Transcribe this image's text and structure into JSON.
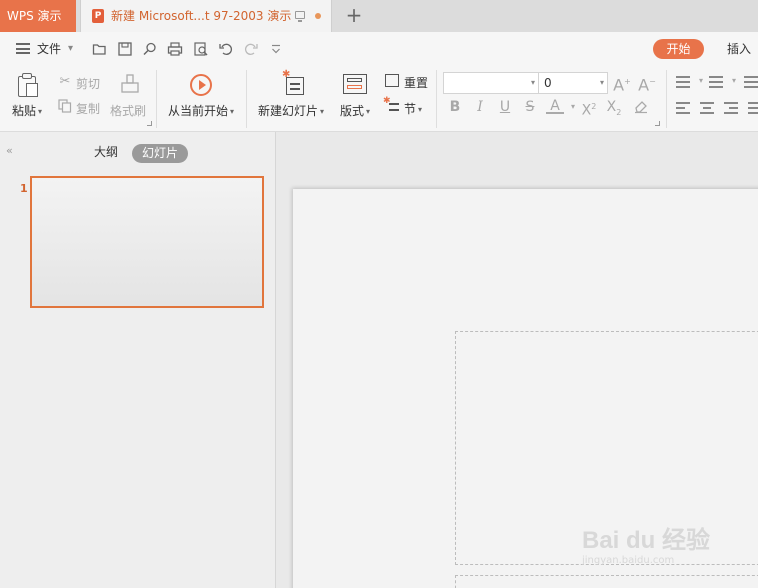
{
  "titlebar": {
    "app_tab": "WPS 演示",
    "doc_tab_title": "新建 Microsoft...t 97-2003 演示",
    "new_tab": "+"
  },
  "quickbar": {
    "file_menu": "文件",
    "start_tab": "开始",
    "insert_tab": "插入"
  },
  "ribbon": {
    "paste": "粘贴",
    "cut": "剪切",
    "copy": "复制",
    "format_painter": "格式刷",
    "from_current": "从当前开始",
    "new_slide": "新建幻灯片",
    "layout": "版式",
    "reset": "重置",
    "section": "节",
    "font_name": "",
    "font_size": "0"
  },
  "left_panel": {
    "tab_outline": "大纲",
    "tab_slides": "幻灯片",
    "slide_number": "1"
  },
  "watermark": {
    "main": "Bai du 经验",
    "sub": "jingyan.baidu.com"
  },
  "colors": {
    "accent": "#e8734a",
    "accent_text": "#d2642f"
  }
}
